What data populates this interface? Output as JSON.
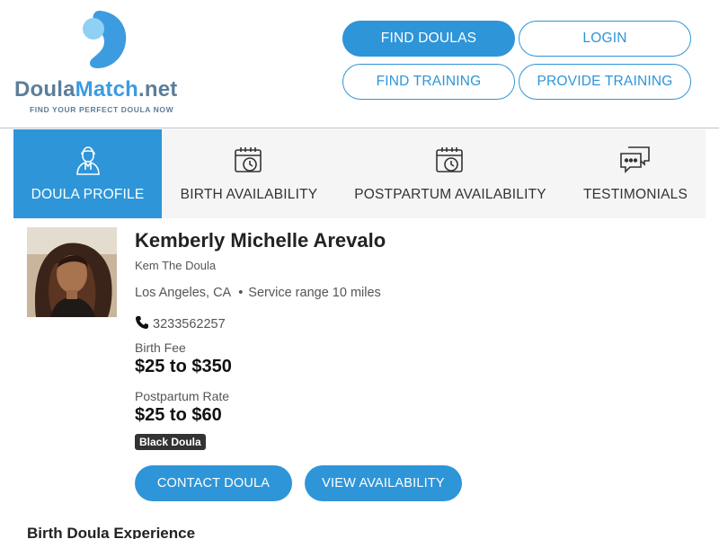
{
  "brand": {
    "name_part1": "Doula",
    "name_part2": "Match",
    "name_part3": ".net",
    "tagline": "FIND YOUR PERFECT DOULA NOW",
    "primary_color": "#2e95d8",
    "logo_gray": "#5b7e9a"
  },
  "header": {
    "find_doulas": "FIND DOULAS",
    "login": "LOGIN",
    "find_training": "FIND TRAINING",
    "provide_training": "PROVIDE TRAINING"
  },
  "tabs": [
    {
      "label": "DOULA PROFILE",
      "icon": "person-icon",
      "active": true
    },
    {
      "label": "BIRTH AVAILABILITY",
      "icon": "calendar-clock-icon",
      "active": false
    },
    {
      "label": "POSTPARTUM AVAILABILITY",
      "icon": "calendar-clock-icon",
      "active": false
    },
    {
      "label": "TESTIMONIALS",
      "icon": "chat-bubbles-icon",
      "active": false
    }
  ],
  "profile": {
    "name": "Kemberly Michelle Arevalo",
    "nickname": "Kem The Doula",
    "city": "Los Angeles, CA",
    "service_range": "Service range 10 miles",
    "phone": "3233562257",
    "birth_fee_label": "Birth Fee",
    "birth_fee_value": "$25 to $350",
    "postpartum_rate_label": "Postpartum Rate",
    "postpartum_rate_value": "$25 to $60",
    "badge": "Black Doula",
    "contact_button": "CONTACT DOULA",
    "availability_button": "VIEW AVAILABILITY"
  },
  "sections": {
    "experience_heading": "Birth Doula Experience"
  }
}
